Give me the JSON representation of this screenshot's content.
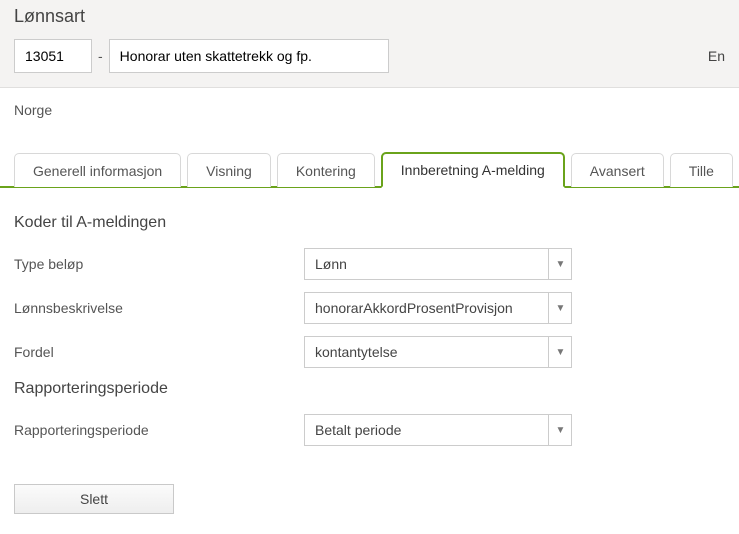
{
  "header": {
    "title": "Lønnsart",
    "code": "13051",
    "dash": "-",
    "name": "Honorar uten skattetrekk og fp.",
    "right_fragment": "En"
  },
  "country": "Norge",
  "tabs": [
    {
      "label": "Generell informasjon",
      "active": false
    },
    {
      "label": "Visning",
      "active": false
    },
    {
      "label": "Kontering",
      "active": false
    },
    {
      "label": "Innberetning A-melding",
      "active": true
    },
    {
      "label": "Avansert",
      "active": false
    },
    {
      "label": "Tille",
      "active": false
    }
  ],
  "section1": {
    "heading": "Koder til A-meldingen",
    "rows": [
      {
        "label": "Type beløp",
        "value": "Lønn"
      },
      {
        "label": "Lønnsbeskrivelse",
        "value": "honorarAkkordProsentProvisjon"
      },
      {
        "label": "Fordel",
        "value": "kontantytelse"
      }
    ]
  },
  "section2": {
    "heading": "Rapporteringsperiode",
    "rows": [
      {
        "label": "Rapporteringsperiode",
        "value": "Betalt periode"
      }
    ]
  },
  "buttons": {
    "delete": "Slett"
  }
}
